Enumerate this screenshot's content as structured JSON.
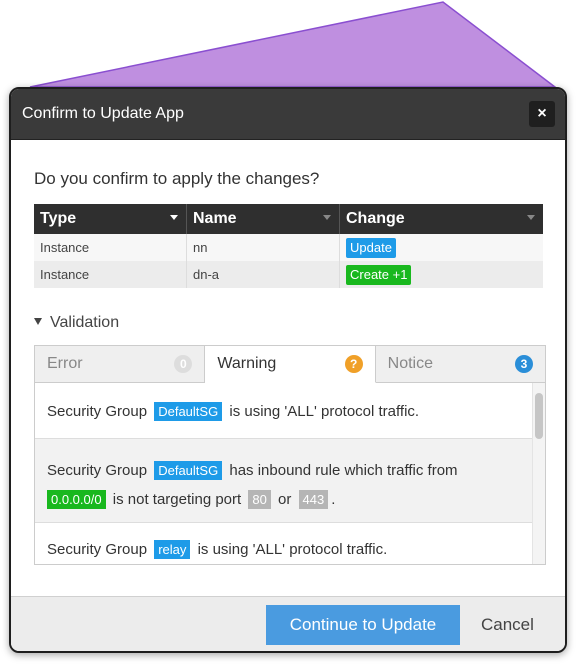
{
  "dialog": {
    "title": "Confirm to Update App",
    "close_label": "×",
    "question": "Do you confirm to apply the changes?"
  },
  "table": {
    "headers": [
      "Type",
      "Name",
      "Change"
    ],
    "rows": [
      {
        "type": "Instance",
        "name": "nn",
        "change": "Update",
        "change_color": "#1e9be8"
      },
      {
        "type": "Instance",
        "name": "dn-a",
        "change": "Create +1",
        "change_color": "#19b81e"
      }
    ]
  },
  "validation": {
    "label": "Validation",
    "tabs": [
      {
        "label": "Error",
        "count": "0",
        "active": false
      },
      {
        "label": "Warning",
        "count": "?",
        "active": true
      },
      {
        "label": "Notice",
        "count": "3",
        "active": false
      }
    ],
    "messages": [
      {
        "prefix": "Security Group",
        "tag": "DefaultSG",
        "text": "is using 'ALL' protocol traffic."
      },
      {
        "prefix": "Security Group",
        "tag": "DefaultSG",
        "text": "has inbound rule which traffic from",
        "cidr": "0.0.0.0/0",
        "text2": "is not targeting port",
        "port1": "80",
        "or": "or",
        "port2": "443",
        "end": "."
      },
      {
        "prefix": "Security Group",
        "tag": "relay",
        "text": "is using 'ALL' protocol traffic."
      }
    ]
  },
  "footer": {
    "primary_label": "Continue to Update",
    "cancel_label": "Cancel"
  },
  "colors": {
    "background_shape": "#bf8fe0",
    "background_shape_stroke": "#8a4fd0",
    "accent": "#4a9be0"
  }
}
